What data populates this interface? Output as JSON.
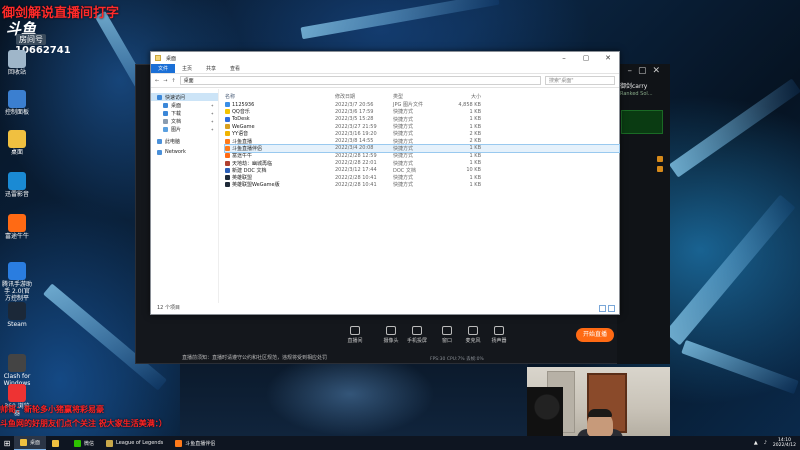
{
  "stream_overlay": {
    "title": "御剑解说直播间打字",
    "logo_text": "斗鱼",
    "room_label": "房间号",
    "room_number": "10662741"
  },
  "desktop_icons": [
    {
      "label": "回收站",
      "icon": "recycle-bin-icon",
      "color": "#9fb6c9"
    },
    {
      "label": "控制面板",
      "icon": "control-panel-icon",
      "color": "#3b7fd0"
    },
    {
      "label": "桌面",
      "icon": "folder-icon",
      "color": "#f0c040"
    },
    {
      "label": "迅雷影音",
      "icon": "xunlei-icon",
      "color": "#1a8ad4"
    },
    {
      "label": "富途牛牛",
      "icon": "futu-icon",
      "color": "#ff6a14"
    },
    {
      "label": "腾讯手游助手 2.0(官方控制平台)",
      "icon": "tencent-icon",
      "color": "#2a7de0"
    },
    {
      "label": "Steam",
      "icon": "steam-icon",
      "color": "#1b2838"
    },
    {
      "label": "Clash for Windows",
      "icon": "clash-icon",
      "color": "#444"
    },
    {
      "label": "360 浏览器",
      "icon": "browser-icon",
      "color": "#e33"
    }
  ],
  "explorer": {
    "title": "桌面",
    "ribbon_tabs": [
      "文件",
      "主页",
      "共享",
      "查看"
    ],
    "address": "桌面",
    "search_placeholder": "搜索\"桌面\"",
    "nav_items": [
      {
        "label": "快速访问",
        "icon": "star-icon",
        "color": "#3b87d8",
        "level": 0,
        "selected": true
      },
      {
        "label": "桌面",
        "icon": "desktop-icon",
        "color": "#3b87d8",
        "level": 1
      },
      {
        "label": "下载",
        "icon": "download-icon",
        "color": "#3b87d8",
        "level": 1
      },
      {
        "label": "文档",
        "icon": "document-icon",
        "color": "#8a9cb0",
        "level": 1
      },
      {
        "label": "图片",
        "icon": "picture-icon",
        "color": "#5aa0e0",
        "level": 1
      },
      {
        "label": "此电脑",
        "icon": "computer-icon",
        "color": "#4a90d9",
        "level": 0
      },
      {
        "label": "Network",
        "icon": "network-icon",
        "color": "#4a90d9",
        "level": 0
      }
    ],
    "columns": [
      "名称",
      "修改日期",
      "类型",
      "大小"
    ],
    "files": [
      {
        "name": "1125936",
        "date": "2022/3/7 20:56",
        "type": "JPG 图片文件",
        "size": "4,858 KB",
        "color": "#3a8ee6",
        "selected": false
      },
      {
        "name": "QQ音乐",
        "date": "2022/3/6 17:59",
        "type": "快捷方式",
        "size": "1 KB",
        "color": "#f5c400",
        "selected": false
      },
      {
        "name": "ToDesk",
        "date": "2022/3/5 15:28",
        "type": "快捷方式",
        "size": "1 KB",
        "color": "#2f6fe0",
        "selected": false
      },
      {
        "name": "WeGame",
        "date": "2022/3/27 21:59",
        "type": "快捷方式",
        "size": "1 KB",
        "color": "#d8a020",
        "selected": false
      },
      {
        "name": "YY语音",
        "date": "2022/3/16 19:20",
        "type": "快捷方式",
        "size": "2 KB",
        "color": "#f0b400",
        "selected": false
      },
      {
        "name": "斗鱼直播",
        "date": "2022/3/8 14:55",
        "type": "快捷方式",
        "size": "2 KB",
        "color": "#ff7a1a",
        "selected": false
      },
      {
        "name": "斗鱼直播伴侣",
        "date": "2022/3/4 20:08",
        "type": "快捷方式",
        "size": "1 KB",
        "color": "#ff7a1a",
        "selected": true
      },
      {
        "name": "富途牛牛",
        "date": "2022/2/28 12:59",
        "type": "快捷方式",
        "size": "1 KB",
        "color": "#ff6a14",
        "selected": false
      },
      {
        "name": "天地劫：幽城再临",
        "date": "2022/2/28 22:01",
        "type": "快捷方式",
        "size": "1 KB",
        "color": "#b04030",
        "selected": false
      },
      {
        "name": "新建 DOC 文档",
        "date": "2022/3/12 17:44",
        "type": "DOC 文档",
        "size": "10 KB",
        "color": "#2b5fb8",
        "selected": false
      },
      {
        "name": "英雄联盟",
        "date": "2022/2/28 10:41",
        "type": "快捷方式",
        "size": "1 KB",
        "color": "#1f2a38",
        "selected": false
      },
      {
        "name": "英雄联盟WeGame版",
        "date": "2022/2/28 10:41",
        "type": "快捷方式",
        "size": "1 KB",
        "color": "#1f2a38",
        "selected": false
      }
    ],
    "status": "12 个项目"
  },
  "live_panel": {
    "streamer_name": "御剑carry",
    "streamer_sub": "Ranked Sol...",
    "tools": [
      {
        "label": "直播间",
        "icon": "live-room-icon"
      },
      {
        "label": "摄像头",
        "icon": "camera-icon"
      },
      {
        "label": "手机投屏",
        "icon": "phone-cast-icon"
      },
      {
        "label": "窗口",
        "icon": "window-icon"
      },
      {
        "label": "麦克风",
        "icon": "microphone-icon"
      },
      {
        "label": "扬声器",
        "icon": "speaker-icon"
      }
    ],
    "go_live_label": "开始直播",
    "notice": "直播前须知：直播时请遵守公约和社区规范，违规将受到相应处罚",
    "status": "FPS:30  CPU:7%  丢帧:0%"
  },
  "chat": [
    "帅哥：新轮多小猪赢将彩易豪",
    "斗鱼网的好朋友们点个关注 祝大家生活美满：）"
  ],
  "taskbar": {
    "start_icon": "windows-logo-icon",
    "apps": [
      {
        "label": "桌面",
        "color": "#f0c040",
        "active": true
      },
      {
        "label": "",
        "color": "#f0c040",
        "active": false
      },
      {
        "label": "微信",
        "color": "#2dc100",
        "active": false
      },
      {
        "label": "League of Legends",
        "color": "#c8a84a",
        "active": false
      },
      {
        "label": "斗鱼直播伴侣",
        "color": "#ff7a1a",
        "active": false
      }
    ],
    "time": "14:10",
    "date": "2022/4/12"
  }
}
